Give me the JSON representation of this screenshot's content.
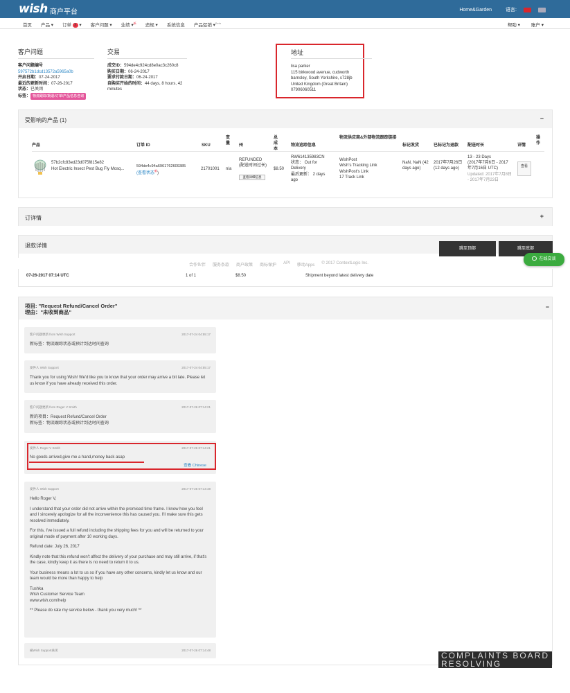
{
  "header": {
    "logo": "wish",
    "brand_sub": "商户平台",
    "store": "Home&Garden",
    "lang_label": "语言:",
    "flag_cn": "cn-flag",
    "flag_en": "uk-flag"
  },
  "nav": {
    "items": [
      {
        "label": "首页"
      },
      {
        "label": "产品 ▾"
      },
      {
        "label": "订单",
        "badge": "3",
        "tail": " ▾"
      },
      {
        "label": "客户问题 ▾"
      },
      {
        "label": "业绩 ▾",
        "sup": "新"
      },
      {
        "label": "违规 ▾"
      },
      {
        "label": "系统信息"
      },
      {
        "label": "产品促销 ▾",
        "sup": "Beta"
      }
    ],
    "right": [
      "帮助 ▾",
      "账户 ▾"
    ]
  },
  "ticket": {
    "title": "客户问题",
    "id_label": "客户问题编号",
    "id": "597572b1dcd13572a5965a0b",
    "open_label": "开启日期：",
    "open": "07-24-2017",
    "update_label": "最近的更新时间：",
    "update": "07-26-2017",
    "status_label": "状态：",
    "status": "已关闭",
    "tag_label": "标签：",
    "tag": "物流跟踪/期退/订单/产品信息咨询"
  },
  "transaction": {
    "title": "交易",
    "txn_label": "成交ID：",
    "txn": "594de4c924cd8e0ac3c260c8",
    "buy_label": "购买日期：",
    "buy": "06-24-2017",
    "req_label": "要求付款日期：",
    "req": "06-24-2017",
    "since_label": "自购买开始的时间：",
    "since": "44 days, 8 hours, 42 minutes"
  },
  "address": {
    "title": "地址",
    "lines": [
      "lisa parker",
      "115 birkwood avenue, cudworth",
      "barnsley, South Yorkshire, s728jb",
      "United Kingdom (Great Britain)",
      "07906060511"
    ]
  },
  "products": {
    "title": "受影响的产品 (1)",
    "toggle": "−",
    "headers": {
      "product": "产品",
      "order": "订单 ID",
      "sku": "SKU",
      "qty": "变量",
      "state": "州",
      "total": "总成本",
      "tracking": "物流追踪信息",
      "provider": "物流供应商&外部物流跟踪链接",
      "mark": "标记发货",
      "refund": "已标记为退款",
      "ship": "配送时长",
      "detail": "详情",
      "op": "操作"
    },
    "row": {
      "id": "57b2cfc83ed23d075f815e82",
      "name": "Hot Electric Insect Pest Bug Fly Mosq...",
      "order": "594de4c94a6961762609385",
      "order_link": "(查看状态",
      "order_sup": "新",
      "order_end": ")",
      "sku": "21701001",
      "qty": "n/a",
      "state1": "REFUNDED",
      "state2": "(配送时间过长)",
      "state_btn": "查看详细信息",
      "total": "$8.50",
      "track_no": "RW614135983CN",
      "track_status": "状态： Out for Delivery",
      "track_update": "最后更新： 2 days ago",
      "provider": "WishPost",
      "provider_links": [
        "Wish's Tracking Link",
        "WishPost's Link",
        "17 Track Link"
      ],
      "mark": "NaN, NaN (42 days ago)",
      "refund": "2017年7月26日 (12 days ago)",
      "ship1": "13 - 23 Days",
      "ship2": "(2017年7月6日 - 2017年7月16日 UTC)",
      "ship3": "Updated: 2017年7月8日 - 2017年7月23日",
      "detail_btn": "查看"
    }
  },
  "order_detail": {
    "title": "订详情",
    "toggle": "+"
  },
  "refund": {
    "title": "退款详情",
    "btn_top": "跳至顶部",
    "btn_bottom": "跳至底部",
    "date": "07-26-2017 07:14 UTC",
    "count": "1 of 1",
    "amount": "$8.50",
    "reason": "Shipment beyond latest delivery date"
  },
  "footer": {
    "links": [
      "合作伙伴",
      "服务条款",
      "商户政策",
      "商标保护",
      "API",
      "移动Apps",
      "© 2017 ContextLogic Inc."
    ],
    "chat": "在线交谈"
  },
  "thread": {
    "title1": "项目: \"Request Refund/Cancel Order\"",
    "title2": "理由：\"未收到商品\"",
    "translate": "查看 Chinese",
    "messages": [
      {
        "from": "客户问题更新 from Wish Support",
        "time": "2017-07-24 04:55:17",
        "lines": [
          "新标签：物流跟踪状态或预计到达时间查询"
        ]
      },
      {
        "from": "发件人 Wish Support",
        "time": "2017-07-24 04:55:17",
        "lines": [
          "Thank you for using Wish! We'd like you to know that your order may arrive a bit late. Please let us know if you have already received this order."
        ]
      },
      {
        "from": "客户问题更新 from Roger V Smith",
        "time": "2017-07-26 07:14:21",
        "lines": [
          "新的项目：Request Refund/Cancel Order",
          "新标签：物流跟踪状态或预计到达时间查询"
        ]
      },
      {
        "from": "发件人 Roger V Smith",
        "time": "2017-07-26 07:14:21",
        "lines": [
          "No goods arrived,give me a hand,money back asap"
        ]
      },
      {
        "from": "发件人 Wish Support",
        "time": "2017-07-26 07:14:48",
        "lines": [
          "Hello Roger V,",
          "I understand that your order did not arrive within the promised time frame. I know how you feel and I sincerely apologize for all the inconvenience this has caused you. I'll make sure this gets resolved immediately.",
          "For this, I've issued a full refund including the shipping fees for you and will be returned to your original mode of payment after 10 working days.",
          "Refund date: July 26, 2017",
          "Kindly note that this refund won't affect the delivery of your purchase and may still arrive, if that's the case, kindly keep it as there is no need to return it to us.",
          "Your business means a lot to us so if you have any other concerns, kindly let us know and our team would be more than happy to help",
          "Tushka\nWish Customer Service Team\nwww.wish.com/help",
          "** Please do rate my service below - thank you very much! **"
        ]
      },
      {
        "from": "被Wish Support关闭",
        "time": "2017-07-26 07:14:48",
        "lines": []
      }
    ]
  },
  "watermark": "COMPLAINTS BOARD RESOLVING"
}
